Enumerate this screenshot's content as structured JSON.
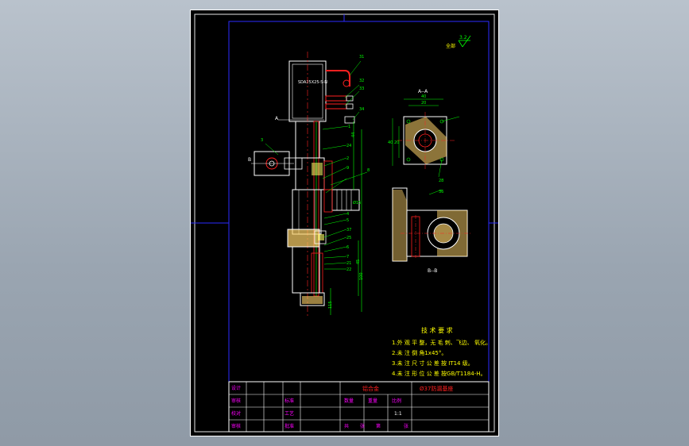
{
  "drawing": {
    "section_a_title": "A--A",
    "section_b_title": "B--B",
    "roughness_mark": "3.2",
    "roughness_note": "全部",
    "cylinder_label": "SDA25X25-S-N",
    "view_marker_a": "A",
    "view_marker_b": "B",
    "dimensions": {
      "width_40": "40",
      "width_20": "20",
      "height_40": "40",
      "height_20": "20",
      "vertical_45": "45",
      "vertical_44": "44",
      "vertical_100": "100",
      "vertical_115": "115",
      "diameter_15": "Ø15"
    },
    "part_callouts": [
      "31",
      "32",
      "33",
      "34",
      "1",
      "24",
      "3",
      "2",
      "8",
      "9",
      "4",
      "5",
      "37",
      "25",
      "6",
      "7",
      "21",
      "22",
      "35",
      "36",
      "28"
    ],
    "technical_requirements": {
      "heading": "技 术 要 求",
      "items": [
        "1.外 观 平 整，无 毛 刺、飞边、 氧化。",
        "2.未 注 倒 角1x45°。",
        "3.未 注 尺 寸 公 差 按 IT14 级。",
        "4.未 注 形 位 公 差 按GB/T1184-H。"
      ]
    }
  },
  "title_block": {
    "left_labels": [
      "设计",
      "审核",
      "校对",
      "审核"
    ],
    "mid_labels": [
      "标准",
      "工艺",
      "批准"
    ],
    "material": "铝合金",
    "part_name": "Ø37防漏基座",
    "small_headers": [
      "数量",
      "重量",
      "比例"
    ],
    "scale": "1:1",
    "sheet_labels": [
      "共",
      "张",
      "第",
      "张"
    ]
  }
}
